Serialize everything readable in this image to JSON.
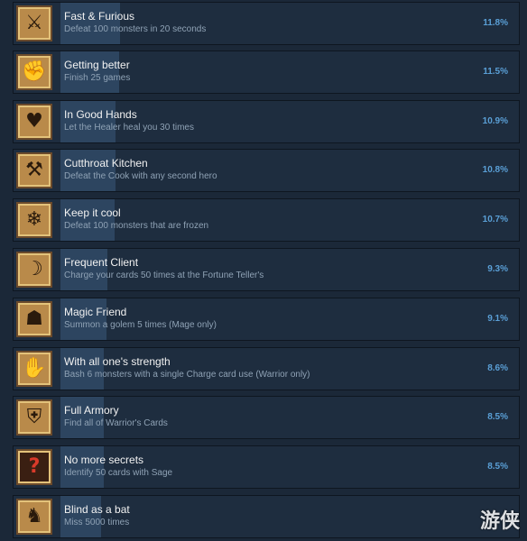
{
  "achievements": [
    {
      "title": "Fast & Furious",
      "description": "Defeat 100 monsters in 20 seconds",
      "percent": "11.8%",
      "icon": "running-hero-icon",
      "bar": 0.118
    },
    {
      "title": "Getting better",
      "description": "Finish 25 games",
      "percent": "11.5%",
      "icon": "flexing-arm-icon",
      "bar": 0.115
    },
    {
      "title": "In Good Hands",
      "description": "Let the Healer heal you 30 times",
      "percent": "10.9%",
      "icon": "healing-pouch-icon",
      "bar": 0.109
    },
    {
      "title": "Cutthroat Kitchen",
      "description": "Defeat the Cook with any second hero",
      "percent": "10.8%",
      "icon": "cleaver-icon",
      "bar": 0.108
    },
    {
      "title": "Keep it cool",
      "description": "Defeat 100 monsters that are frozen",
      "percent": "10.7%",
      "icon": "frozen-monster-icon",
      "bar": 0.107
    },
    {
      "title": "Frequent Client",
      "description": "Charge your cards 50 times at the Fortune Teller's",
      "percent": "9.3%",
      "icon": "fortune-teller-icon",
      "bar": 0.093
    },
    {
      "title": "Magic Friend",
      "description": "Summon a golem 5 times (Mage only)",
      "percent": "9.1%",
      "icon": "golem-icon",
      "bar": 0.091
    },
    {
      "title": "With all one's strength",
      "description": "Bash 6 monsters with a single Charge card use (Warrior only)",
      "percent": "8.6%",
      "icon": "bash-fist-icon",
      "bar": 0.086
    },
    {
      "title": "Full Armory",
      "description": "Find all of Warrior's Cards",
      "percent": "8.5%",
      "icon": "armory-shield-icon",
      "bar": 0.085
    },
    {
      "title": "No more secrets",
      "description": "Identify 50 cards with Sage",
      "percent": "8.5%",
      "icon": "question-card-icon",
      "bar": 0.085
    },
    {
      "title": "Blind as a bat",
      "description": "Miss 5000 times",
      "percent": "",
      "icon": "bat-icon",
      "bar": 0.08
    }
  ],
  "watermark": "游侠"
}
